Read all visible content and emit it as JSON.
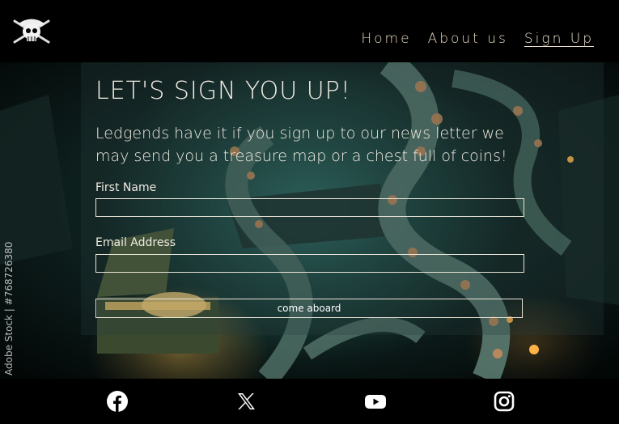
{
  "header": {
    "logo_icon": "pirate-skull-logo",
    "nav": [
      {
        "label": "Home",
        "active": false
      },
      {
        "label": "About us",
        "active": false
      },
      {
        "label": "Sign Up",
        "active": true
      }
    ]
  },
  "hero": {
    "title": "LET'S SIGN YOU UP!",
    "lead": "Ledgends have it if you sign up to our news letter we may send you a treasure map or a chest full of coins!",
    "watermark": "Adobe Stock | #768726380"
  },
  "form": {
    "first_name_label": "First Name",
    "first_name_value": "",
    "email_label": "Email Address",
    "email_value": "",
    "submit_label": "come aboard"
  },
  "footer": {
    "social": [
      "facebook-icon",
      "x-icon",
      "youtube-icon",
      "instagram-icon"
    ]
  },
  "colors": {
    "nav_text": "#e8d6c0",
    "border": "#e9e4d8",
    "background": "#000000"
  }
}
